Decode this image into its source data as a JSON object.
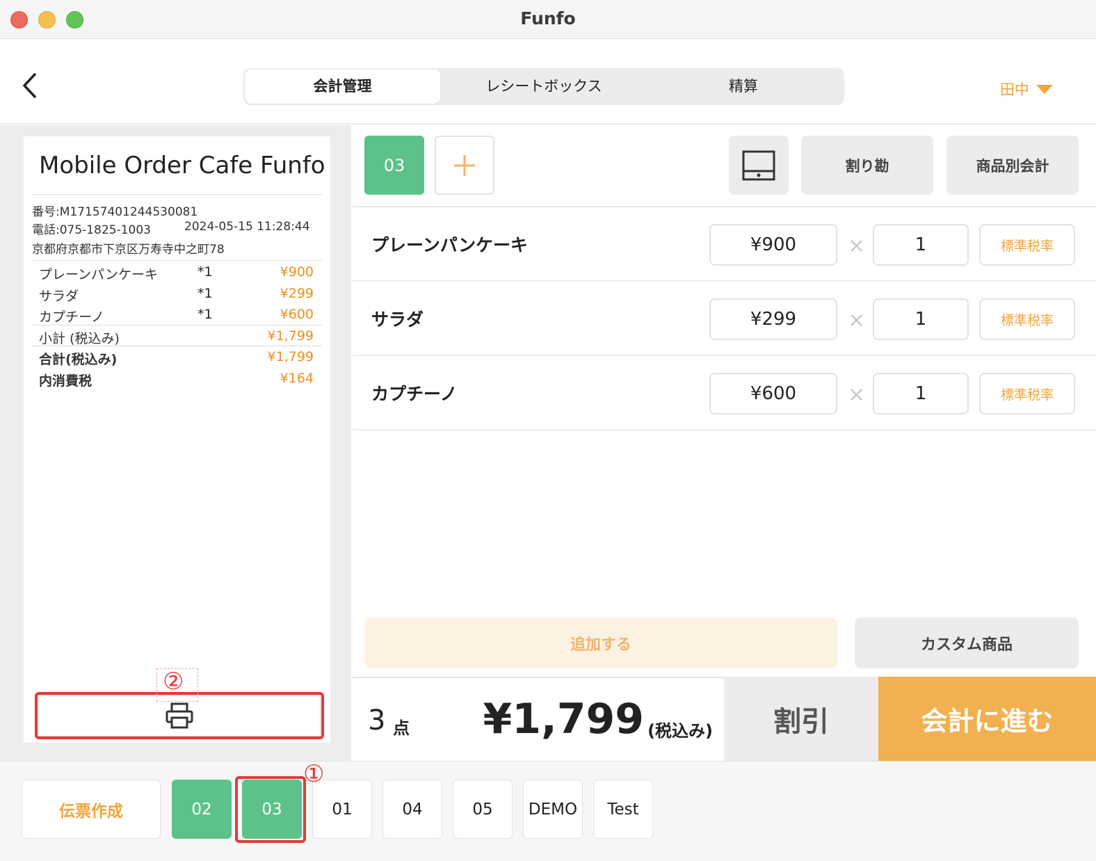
{
  "window": {
    "title": "Funfo"
  },
  "header": {
    "tabs": [
      {
        "label": "会計管理",
        "active": true
      },
      {
        "label": "レシートボックス",
        "active": false
      },
      {
        "label": "精算",
        "active": false
      }
    ],
    "user": "田中"
  },
  "receipt": {
    "store_name": "Mobile Order Cafe Funfo",
    "number": "番号:M17157401244530081",
    "phone": "電話:075-1825-1003",
    "datetime": "2024-05-15 11:28:44",
    "address": "京都府京都市下京区万寿寺中之町78",
    "items": [
      {
        "name": "プレーンパンケーキ",
        "qty": "*1",
        "price": "¥900"
      },
      {
        "name": "サラダ",
        "qty": "*1",
        "price": "¥299"
      },
      {
        "name": "カプチーノ",
        "qty": "*1",
        "price": "¥600"
      }
    ],
    "subtotal_label": "小計 (税込み)",
    "subtotal": "¥1,799",
    "total_label": "合計(税込み)",
    "total": "¥1,799",
    "tax_label": "内消費税",
    "tax": "¥164"
  },
  "order": {
    "active_tab": "03",
    "actions": {
      "split": "割り勘",
      "by_item": "商品別会計"
    },
    "items": [
      {
        "name": "プレーンパンケーキ",
        "price": "¥900",
        "times": "×",
        "qty": "1",
        "tax": "標準税率"
      },
      {
        "name": "サラダ",
        "price": "¥299",
        "times": "×",
        "qty": "1",
        "tax": "標準税率"
      },
      {
        "name": "カプチーノ",
        "price": "¥600",
        "times": "×",
        "qty": "1",
        "tax": "標準税率"
      }
    ],
    "add_label": "追加する",
    "custom_label": "カスタム商品",
    "count": "3",
    "count_unit": "点",
    "total": "¥1,799",
    "total_tax_note": "(税込み)",
    "discount_label": "割引",
    "checkout_label": "会計に進む"
  },
  "bottom": {
    "create_label": "伝票作成",
    "slips": [
      "02",
      "03",
      "01",
      "04",
      "05",
      "DEMO",
      "Test"
    ]
  },
  "annotations": {
    "marker1": "①",
    "marker2": "②"
  },
  "colors": {
    "accent": "#f2b050",
    "green": "#5dc28a",
    "highlight": "#e53935"
  }
}
